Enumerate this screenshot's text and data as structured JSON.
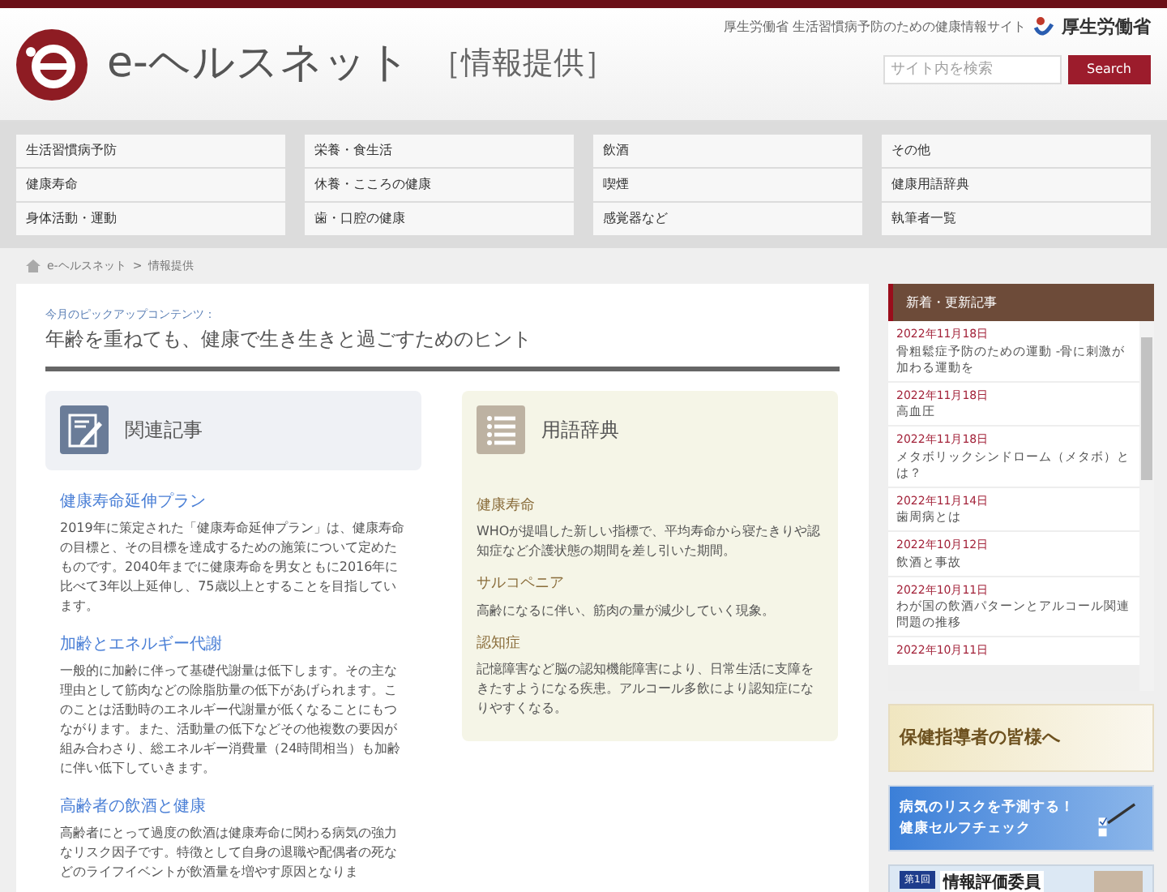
{
  "header": {
    "logo_text": "e-ヘルスネット",
    "logo_suffix": "［情報提供］",
    "tagline": "厚生労働省 生活習慣病予防のための健康情報サイト",
    "ministry": "厚生労働省",
    "search": {
      "placeholder": "サイト内を検索",
      "button": "Search"
    }
  },
  "nav": [
    [
      "生活習慣病予防",
      "健康寿命",
      "身体活動・運動"
    ],
    [
      "栄養・食生活",
      "休養・こころの健康",
      "歯・口腔の健康"
    ],
    [
      "飲酒",
      "喫煙",
      "感覚器など"
    ],
    [
      "その他",
      "健康用語辞典",
      "執筆者一覧"
    ]
  ],
  "breadcrumb": {
    "separator": ">",
    "items": [
      "e-ヘルスネット",
      "情報提供"
    ]
  },
  "pickup": {
    "label": "今月のピックアップコンテンツ：",
    "title": "年齢を重ねても、健康で生き生きと過ごすためのヒント"
  },
  "articles": {
    "heading": "関連記事",
    "items": [
      {
        "title": "健康寿命延伸プラン",
        "text": "2019年に策定された「健康寿命延伸プラン」は、健康寿命の目標と、その目標を達成するための施策について定めたものです。2040年までに健康寿命を男女ともに2016年に比べて3年以上延伸し、75歳以上とすることを目指しています。"
      },
      {
        "title": "加齢とエネルギー代謝",
        "text": "一般的に加齢に伴って基礎代謝量は低下します。その主な理由として筋肉などの除脂肪量の低下があげられます。このことは活動時のエネルギー代謝量が低くなることにもつながります。また、活動量の低下などその他複数の要因が組み合わさり、総エネルギー消費量（24時間相当）も加齢に伴い低下していきます。"
      },
      {
        "title": "高齢者の飲酒と健康",
        "text": "高齢者にとって過度の飲酒は健康寿命に関わる病気の強力なリスク因子です。特徴として自身の退職や配偶者の死などのライフイベントが飲酒量を増やす原因となりま"
      }
    ]
  },
  "glossary": {
    "heading": "用語辞典",
    "items": [
      {
        "term": "健康寿命",
        "text": "WHOが提唱した新しい指標で、平均寿命から寝たきりや認知症など介護状態の期間を差し引いた期間。"
      },
      {
        "term": "サルコペニア",
        "text": "高齢になるに伴い、筋肉の量が減少していく現象。"
      },
      {
        "term": "認知症",
        "text": "記憶障害など脳の認知機能障害により、日常生活に支障をきたすようになる疾患。アルコール多飲により認知症になりやすくなる。"
      }
    ]
  },
  "news": {
    "heading": "新着・更新記事",
    "items": [
      {
        "date": "2022年11月18日",
        "title": "骨粗鬆症予防のための運動 -骨に刺激が加わる運動を"
      },
      {
        "date": "2022年11月18日",
        "title": "高血圧"
      },
      {
        "date": "2022年11月18日",
        "title": "メタボリックシンドローム（メタボ）とは？"
      },
      {
        "date": "2022年11月14日",
        "title": "歯周病とは"
      },
      {
        "date": "2022年10月12日",
        "title": "飲酒と事故"
      },
      {
        "date": "2022年10月11日",
        "title": "わが国の飲酒パターンとアルコール関連問題の推移"
      },
      {
        "date": "2022年10月11日"
      }
    ]
  },
  "banners": [
    {
      "kind": "guide",
      "text": "保健指導者の皆様へ"
    },
    {
      "kind": "check",
      "lines": [
        "病気のリスクを予測する！",
        "健康セルフチェック"
      ]
    },
    {
      "kind": "committee",
      "badge": "第1回",
      "text": "情報評価委員"
    }
  ]
}
